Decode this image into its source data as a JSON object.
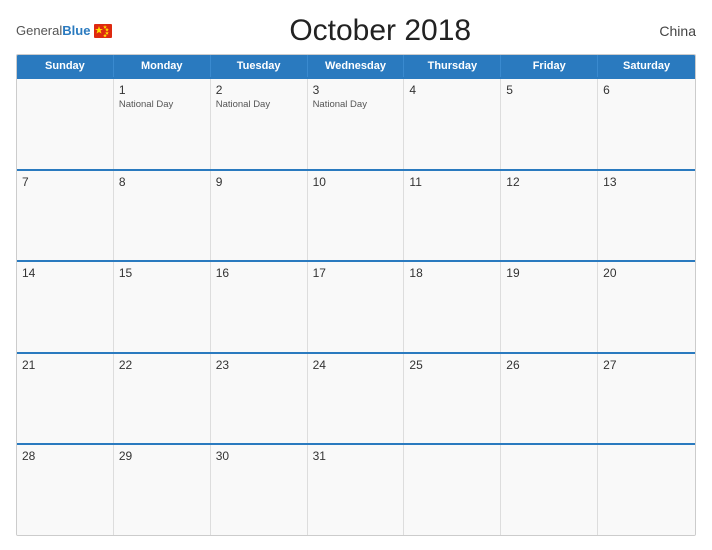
{
  "header": {
    "logo_general": "General",
    "logo_blue": "Blue",
    "title": "October 2018",
    "country": "China"
  },
  "days_of_week": [
    "Sunday",
    "Monday",
    "Tuesday",
    "Wednesday",
    "Thursday",
    "Friday",
    "Saturday"
  ],
  "weeks": [
    [
      {
        "day": "",
        "events": []
      },
      {
        "day": "1",
        "events": [
          "National Day"
        ]
      },
      {
        "day": "2",
        "events": [
          "National Day"
        ]
      },
      {
        "day": "3",
        "events": [
          "National Day"
        ]
      },
      {
        "day": "4",
        "events": []
      },
      {
        "day": "5",
        "events": []
      },
      {
        "day": "6",
        "events": []
      }
    ],
    [
      {
        "day": "7",
        "events": []
      },
      {
        "day": "8",
        "events": []
      },
      {
        "day": "9",
        "events": []
      },
      {
        "day": "10",
        "events": []
      },
      {
        "day": "11",
        "events": []
      },
      {
        "day": "12",
        "events": []
      },
      {
        "day": "13",
        "events": []
      }
    ],
    [
      {
        "day": "14",
        "events": []
      },
      {
        "day": "15",
        "events": []
      },
      {
        "day": "16",
        "events": []
      },
      {
        "day": "17",
        "events": []
      },
      {
        "day": "18",
        "events": []
      },
      {
        "day": "19",
        "events": []
      },
      {
        "day": "20",
        "events": []
      }
    ],
    [
      {
        "day": "21",
        "events": []
      },
      {
        "day": "22",
        "events": []
      },
      {
        "day": "23",
        "events": []
      },
      {
        "day": "24",
        "events": []
      },
      {
        "day": "25",
        "events": []
      },
      {
        "day": "26",
        "events": []
      },
      {
        "day": "27",
        "events": []
      }
    ],
    [
      {
        "day": "28",
        "events": []
      },
      {
        "day": "29",
        "events": []
      },
      {
        "day": "30",
        "events": []
      },
      {
        "day": "31",
        "events": []
      },
      {
        "day": "",
        "events": []
      },
      {
        "day": "",
        "events": []
      },
      {
        "day": "",
        "events": []
      }
    ]
  ]
}
